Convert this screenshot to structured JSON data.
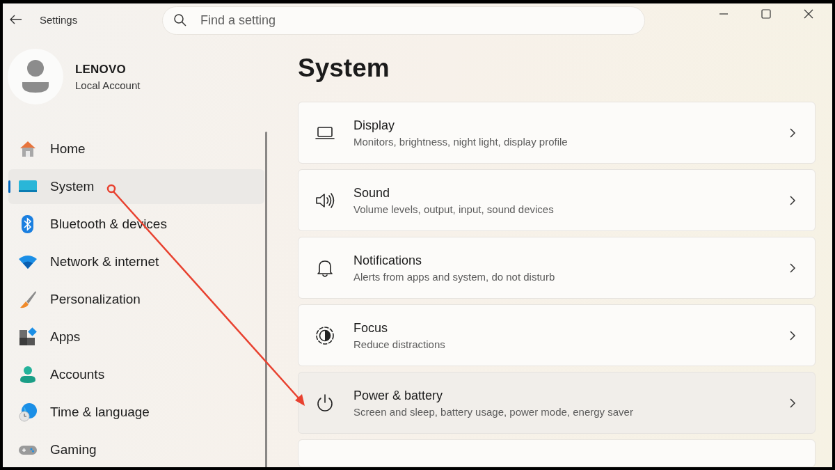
{
  "window": {
    "title": "Settings",
    "controls": [
      {
        "kind": "minimize"
      },
      {
        "kind": "maximize"
      },
      {
        "kind": "close"
      }
    ]
  },
  "search": {
    "placeholder": "Find a setting"
  },
  "profile": {
    "name": "LENOVO",
    "account": "Local Account"
  },
  "sidebar": {
    "items": [
      {
        "label": "Home",
        "selected": false
      },
      {
        "label": "System",
        "selected": true
      },
      {
        "label": "Bluetooth & devices",
        "selected": false
      },
      {
        "label": "Network & internet",
        "selected": false
      },
      {
        "label": "Personalization",
        "selected": false
      },
      {
        "label": "Apps",
        "selected": false
      },
      {
        "label": "Accounts",
        "selected": false
      },
      {
        "label": "Time & language",
        "selected": false
      },
      {
        "label": "Gaming",
        "selected": false
      }
    ]
  },
  "page": {
    "title": "System",
    "cards": [
      {
        "title": "Display",
        "description": "Monitors, brightness, night light, display profile",
        "hovered": false
      },
      {
        "title": "Sound",
        "description": "Volume levels, output, input, sound devices",
        "hovered": false
      },
      {
        "title": "Notifications",
        "description": "Alerts from apps and system, do not disturb",
        "hovered": false
      },
      {
        "title": "Focus",
        "description": "Reduce distractions",
        "hovered": false
      },
      {
        "title": "Power & battery",
        "description": "Screen and sleep, battery usage, power mode, energy saver",
        "hovered": true
      }
    ],
    "more_below": true
  },
  "annotation": {
    "kind": "arrow"
  }
}
